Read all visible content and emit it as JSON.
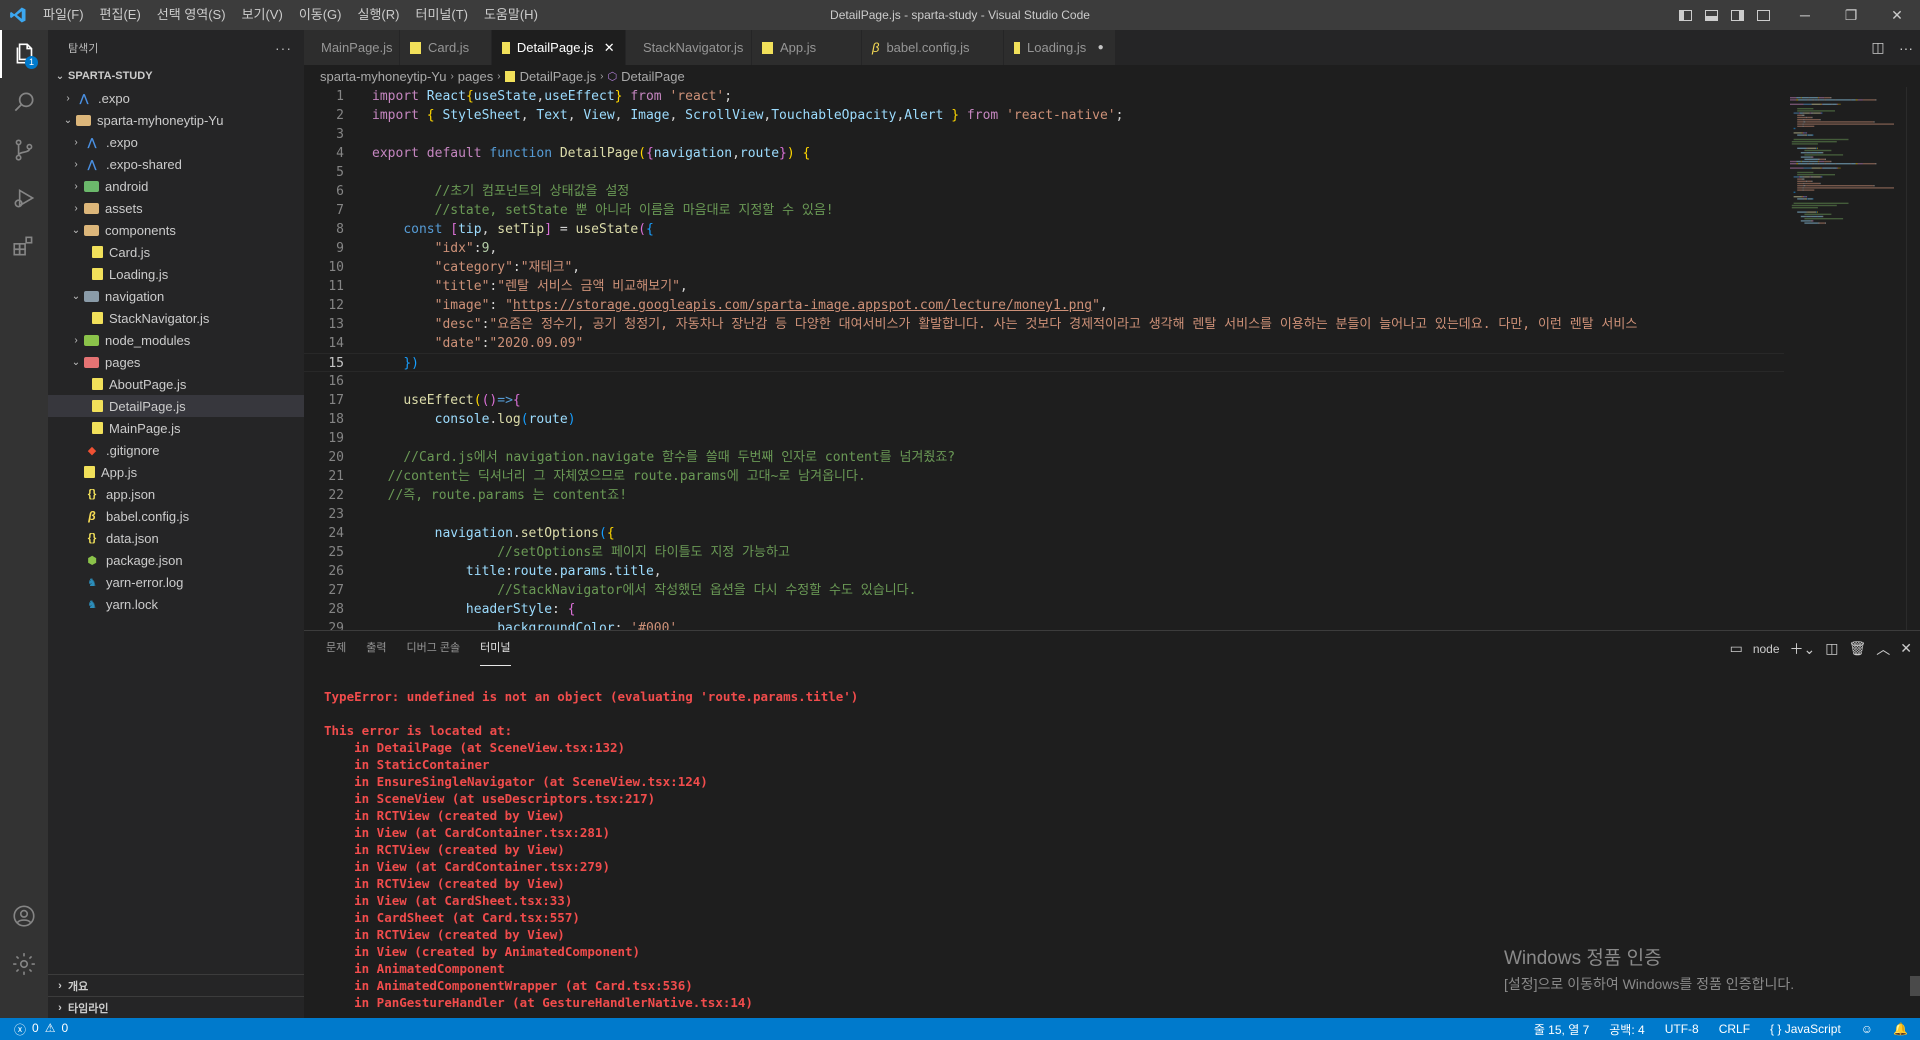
{
  "window": {
    "title": "DetailPage.js - sparta-study - Visual Studio Code",
    "menu": [
      "파일(F)",
      "편집(E)",
      "선택 영역(S)",
      "보기(V)",
      "이동(G)",
      "실행(R)",
      "터미널(T)",
      "도움말(H)"
    ]
  },
  "activity": {
    "explorer_badge": "1"
  },
  "sidebar": {
    "title": "탐색기",
    "more": "···",
    "tree": [
      {
        "label": "SPARTA-STUDY",
        "depth": 0,
        "type": "root",
        "chev": "⌄"
      },
      {
        "label": ".expo",
        "depth": 1,
        "type": "expo-folder",
        "chev": "›"
      },
      {
        "label": "sparta-myhoneytip-Yu",
        "depth": 1,
        "type": "folder-open",
        "chev": "⌄"
      },
      {
        "label": ".expo",
        "depth": 2,
        "type": "expo-folder",
        "chev": "›"
      },
      {
        "label": ".expo-shared",
        "depth": 2,
        "type": "expo-folder",
        "chev": "›"
      },
      {
        "label": "android",
        "depth": 2,
        "type": "folder",
        "chev": "›",
        "color": "#6bb86b"
      },
      {
        "label": "assets",
        "depth": 2,
        "type": "folder",
        "chev": "›"
      },
      {
        "label": "components",
        "depth": 2,
        "type": "folder-open",
        "chev": "⌄"
      },
      {
        "label": "Card.js",
        "depth": 3,
        "type": "js"
      },
      {
        "label": "Loading.js",
        "depth": 3,
        "type": "js"
      },
      {
        "label": "navigation",
        "depth": 2,
        "type": "folder-open",
        "chev": "⌄",
        "color": "#8a9ba8"
      },
      {
        "label": "StackNavigator.js",
        "depth": 3,
        "type": "js"
      },
      {
        "label": "node_modules",
        "depth": 2,
        "type": "folder",
        "chev": "›",
        "color": "#8bc34a"
      },
      {
        "label": "pages",
        "depth": 2,
        "type": "folder-open",
        "chev": "⌄",
        "color": "#e57373"
      },
      {
        "label": "AboutPage.js",
        "depth": 3,
        "type": "js"
      },
      {
        "label": "DetailPage.js",
        "depth": 3,
        "type": "js",
        "selected": true
      },
      {
        "label": "MainPage.js",
        "depth": 3,
        "type": "js"
      },
      {
        "label": ".gitignore",
        "depth": 2,
        "type": "git"
      },
      {
        "label": "App.js",
        "depth": 2,
        "type": "js"
      },
      {
        "label": "app.json",
        "depth": 2,
        "type": "json"
      },
      {
        "label": "babel.config.js",
        "depth": 2,
        "type": "babel"
      },
      {
        "label": "data.json",
        "depth": 2,
        "type": "json"
      },
      {
        "label": "package.json",
        "depth": 2,
        "type": "pkg"
      },
      {
        "label": "yarn-error.log",
        "depth": 2,
        "type": "yarn"
      },
      {
        "label": "yarn.lock",
        "depth": 2,
        "type": "yarn"
      }
    ],
    "sections": [
      "개요",
      "타임라인"
    ]
  },
  "tabs": [
    {
      "label": "MainPage.js",
      "icon": "js",
      "width": 96
    },
    {
      "label": "Card.js",
      "icon": "js",
      "width": 92
    },
    {
      "label": "DetailPage.js",
      "icon": "js",
      "active": true,
      "close": "✕",
      "width": 134
    },
    {
      "label": "StackNavigator.js",
      "icon": "js",
      "width": 126
    },
    {
      "label": "App.js",
      "icon": "js",
      "width": 110
    },
    {
      "label": "babel.config.js",
      "icon": "babel",
      "width": 142
    },
    {
      "label": "Loading.js",
      "icon": "js",
      "dirty": "●",
      "width": 112
    }
  ],
  "breadcrumb": [
    "sparta-myhoneytip-Yu",
    "pages",
    "DetailPage.js",
    "DetailPage"
  ],
  "code": {
    "current_line": 15,
    "lines": [
      [
        [
          "k",
          "import "
        ],
        [
          "v",
          "React"
        ],
        [
          "p",
          "{"
        ],
        [
          "v",
          "useState"
        ],
        [
          "d",
          ","
        ],
        [
          "v",
          "useEffect"
        ],
        [
          "p",
          "}"
        ],
        [
          "k",
          " from "
        ],
        [
          "s",
          "'react'"
        ],
        [
          "d",
          ";"
        ]
      ],
      [
        [
          "k",
          "import "
        ],
        [
          "p",
          "{ "
        ],
        [
          "v",
          "StyleSheet"
        ],
        [
          "d",
          ", "
        ],
        [
          "v",
          "Text"
        ],
        [
          "d",
          ", "
        ],
        [
          "v",
          "View"
        ],
        [
          "d",
          ", "
        ],
        [
          "v",
          "Image"
        ],
        [
          "d",
          ", "
        ],
        [
          "v",
          "ScrollView"
        ],
        [
          "d",
          ","
        ],
        [
          "v",
          "TouchableOpacity"
        ],
        [
          "d",
          ","
        ],
        [
          "v",
          "Alert"
        ],
        [
          "p",
          " }"
        ],
        [
          "k",
          " from "
        ],
        [
          "s",
          "'react-native'"
        ],
        [
          "d",
          ";"
        ]
      ],
      [],
      [
        [
          "k",
          "export default "
        ],
        [
          "kw",
          "function "
        ],
        [
          "f",
          "DetailPage"
        ],
        [
          "p",
          "("
        ],
        [
          "pp",
          "{"
        ],
        [
          "v",
          "navigation"
        ],
        [
          "d",
          ","
        ],
        [
          "v",
          "route"
        ],
        [
          "pp",
          "}"
        ],
        [
          "p",
          ")"
        ],
        [
          "d",
          " "
        ],
        [
          "p",
          "{"
        ]
      ],
      [],
      [
        [
          "d",
          "        "
        ],
        [
          "c",
          "//초기 컴포넌트의 상태값을 설정"
        ]
      ],
      [
        [
          "d",
          "        "
        ],
        [
          "c",
          "//state, setState 뿐 아니라 이름을 마음대로 지정할 수 있음!"
        ]
      ],
      [
        [
          "d",
          "    "
        ],
        [
          "kw",
          "const "
        ],
        [
          "pp",
          "["
        ],
        [
          "v",
          "tip"
        ],
        [
          "d",
          ", "
        ],
        [
          "f",
          "setTip"
        ],
        [
          "pp",
          "]"
        ],
        [
          "d",
          " = "
        ],
        [
          "f",
          "useState"
        ],
        [
          "pp",
          "("
        ],
        [
          "pb",
          "{"
        ]
      ],
      [
        [
          "d",
          "        "
        ],
        [
          "s",
          "\"idx\""
        ],
        [
          "d",
          ":"
        ],
        [
          "n",
          "9"
        ],
        [
          "d",
          ","
        ]
      ],
      [
        [
          "d",
          "        "
        ],
        [
          "s",
          "\"category\""
        ],
        [
          "d",
          ":"
        ],
        [
          "s",
          "\"재테크\""
        ],
        [
          "d",
          ","
        ]
      ],
      [
        [
          "d",
          "        "
        ],
        [
          "s",
          "\"title\""
        ],
        [
          "d",
          ":"
        ],
        [
          "s",
          "\"렌탈 서비스 금액 비교해보기\""
        ],
        [
          "d",
          ","
        ]
      ],
      [
        [
          "d",
          "        "
        ],
        [
          "s",
          "\"image\""
        ],
        [
          "d",
          ": "
        ],
        [
          "s",
          "\""
        ],
        [
          "u",
          "https://storage.googleapis.com/sparta-image.appspot.com/lecture/money1.png"
        ],
        [
          "s",
          "\""
        ],
        [
          "d",
          ","
        ]
      ],
      [
        [
          "d",
          "        "
        ],
        [
          "s",
          "\"desc\""
        ],
        [
          "d",
          ":"
        ],
        [
          "s",
          "\"요즘은 정수기, 공기 청정기, 자동차나 장난감 등 다양한 대여서비스가 활발합니다. 사는 것보다 경제적이라고 생각해 렌탈 서비스를 이용하는 분들이 늘어나고 있는데요. 다만, 이런 렌탈 서비스"
        ]
      ],
      [
        [
          "d",
          "        "
        ],
        [
          "s",
          "\"date\""
        ],
        [
          "d",
          ":"
        ],
        [
          "s",
          "\"2020.09.09\""
        ]
      ],
      [
        [
          "d",
          "    "
        ],
        [
          "pb",
          "})"
        ]
      ],
      [],
      [
        [
          "d",
          "    "
        ],
        [
          "f",
          "useEffect"
        ],
        [
          "p",
          "("
        ],
        [
          "pp",
          "()"
        ],
        [
          "kw",
          "=>"
        ],
        [
          "pp",
          "{"
        ]
      ],
      [
        [
          "d",
          "        "
        ],
        [
          "v",
          "console"
        ],
        [
          "d",
          "."
        ],
        [
          "f",
          "log"
        ],
        [
          "pb",
          "("
        ],
        [
          "v",
          "route"
        ],
        [
          "pb",
          ")"
        ]
      ],
      [],
      [
        [
          "d",
          "    "
        ],
        [
          "c",
          "//Card.js에서 navigation.navigate 함수를 쓸때 두번째 인자로 content를 넘겨줬죠?"
        ]
      ],
      [
        [
          "d",
          "  "
        ],
        [
          "c",
          "//content는 딕셔너리 그 자체였으므로 route.params에 고대~로 남겨옵니다."
        ]
      ],
      [
        [
          "d",
          "  "
        ],
        [
          "c",
          "//즉, route.params 는 content죠!"
        ]
      ],
      [],
      [
        [
          "d",
          "        "
        ],
        [
          "v",
          "navigation"
        ],
        [
          "d",
          "."
        ],
        [
          "f",
          "setOptions"
        ],
        [
          "pb",
          "("
        ],
        [
          "p",
          "{"
        ]
      ],
      [
        [
          "d",
          "                "
        ],
        [
          "c",
          "//setOptions로 페이지 타이틀도 지정 가능하고"
        ]
      ],
      [
        [
          "d",
          "            "
        ],
        [
          "v",
          "title"
        ],
        [
          "d",
          ":"
        ],
        [
          "v",
          "route"
        ],
        [
          "d",
          "."
        ],
        [
          "v",
          "params"
        ],
        [
          "d",
          "."
        ],
        [
          "v",
          "title"
        ],
        [
          "d",
          ","
        ]
      ],
      [
        [
          "d",
          "                "
        ],
        [
          "c",
          "//StackNavigator에서 작성했던 옵션을 다시 수정할 수도 있습니다."
        ]
      ],
      [
        [
          "d",
          "            "
        ],
        [
          "v",
          "headerStyle"
        ],
        [
          "d",
          ": "
        ],
        [
          "pp",
          "{"
        ]
      ],
      [
        [
          "d",
          "                "
        ],
        [
          "v",
          "backgroundColor"
        ],
        [
          "d",
          ": "
        ],
        [
          "s",
          "'#000'"
        ],
        [
          "d",
          ","
        ]
      ]
    ]
  },
  "panel": {
    "tabs": [
      "문제",
      "출력",
      "디버그 콘솔",
      "터미널"
    ],
    "active_tab": 3,
    "shell": "node",
    "terminal_lines": [
      "TypeError: undefined is not an object (evaluating 'route.params.title')",
      "",
      "This error is located at:",
      "    in DetailPage (at SceneView.tsx:132)",
      "    in StaticContainer",
      "    in EnsureSingleNavigator (at SceneView.tsx:124)",
      "    in SceneView (at useDescriptors.tsx:217)",
      "    in RCTView (created by View)",
      "    in View (at CardContainer.tsx:281)",
      "    in RCTView (created by View)",
      "    in View (at CardContainer.tsx:279)",
      "    in RCTView (created by View)",
      "    in View (at CardSheet.tsx:33)",
      "    in CardSheet (at Card.tsx:557)",
      "    in RCTView (created by View)",
      "    in View (created by AnimatedComponent)",
      "    in AnimatedComponent",
      "    in AnimatedComponentWrapper (at Card.tsx:536)",
      "    in PanGestureHandler (at GestureHandlerNative.tsx:14)"
    ],
    "watermark_title": "Windows 정품 인증",
    "watermark_sub": "[설정]으로 이동하여 Windows를 정품 인증합니다."
  },
  "status": {
    "errors": "0",
    "warnings": "0",
    "position": "줄 15, 열 7",
    "spaces": "공백: 4",
    "encoding": "UTF-8",
    "eol": "CRLF",
    "language_braces": "{ }",
    "language": "JavaScript"
  },
  "colors": {
    "accent": "#007acc",
    "error": "#f14c4c",
    "js_icon": "#f1e05a"
  }
}
